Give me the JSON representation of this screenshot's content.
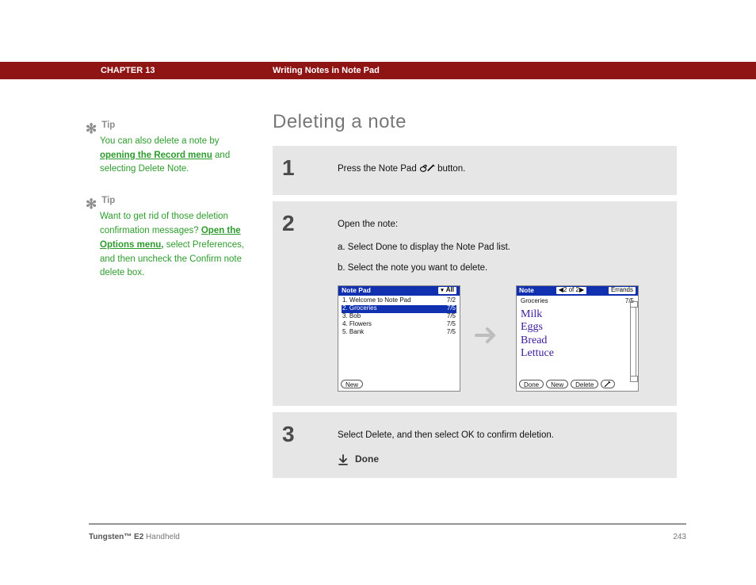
{
  "chapter": {
    "label": "CHAPTER 13",
    "title": "Writing Notes in Note Pad"
  },
  "page_title": "Deleting a note",
  "tips": [
    {
      "head": "Tip",
      "body_parts": {
        "p1": "You can also delete a note by ",
        "link": "opening the Record menu",
        "p2": " and selecting Delete Note."
      }
    },
    {
      "head": "Tip",
      "body_parts": {
        "p1": "Want to get rid of those deletion confirmation messages? ",
        "link": "Open the Options menu,",
        "p2": " select Preferences, and then uncheck the Confirm note delete box."
      }
    }
  ],
  "steps": {
    "one": {
      "num": "1",
      "text_a": "Press the Note Pad ",
      "text_b": " button."
    },
    "two": {
      "num": "2",
      "lead": "Open the note:",
      "a": "a.  Select Done to display the Note Pad list.",
      "b": "b.  Select the note you want to delete."
    },
    "three": {
      "num": "3",
      "text": "Select Delete, and then select OK to confirm deletion.",
      "done": "Done"
    }
  },
  "shot1": {
    "title": "Note Pad",
    "dropdown": "All",
    "rows": [
      {
        "n": "1.",
        "t": "Welcome to Note Pad",
        "d": "7/2"
      },
      {
        "n": "2.",
        "t": "Groceries",
        "d": "7/5"
      },
      {
        "n": "3.",
        "t": "Bob",
        "d": "7/5"
      },
      {
        "n": "4.",
        "t": "Flowers",
        "d": "7/5"
      },
      {
        "n": "5.",
        "t": "Bank",
        "d": "7/5"
      }
    ],
    "new_btn": "New"
  },
  "shot2": {
    "title": "Note",
    "counter": "2 of 2",
    "category": "Errands",
    "subject": "Groceries",
    "date": "7/5",
    "hand": [
      "Milk",
      "Eggs",
      "Bread",
      "Lettuce"
    ],
    "buttons": {
      "done": "Done",
      "new": "New",
      "delete": "Delete"
    }
  },
  "footer": {
    "product_bold": "Tungsten™ E2",
    "product_rest": " Handheld",
    "page": "243"
  }
}
